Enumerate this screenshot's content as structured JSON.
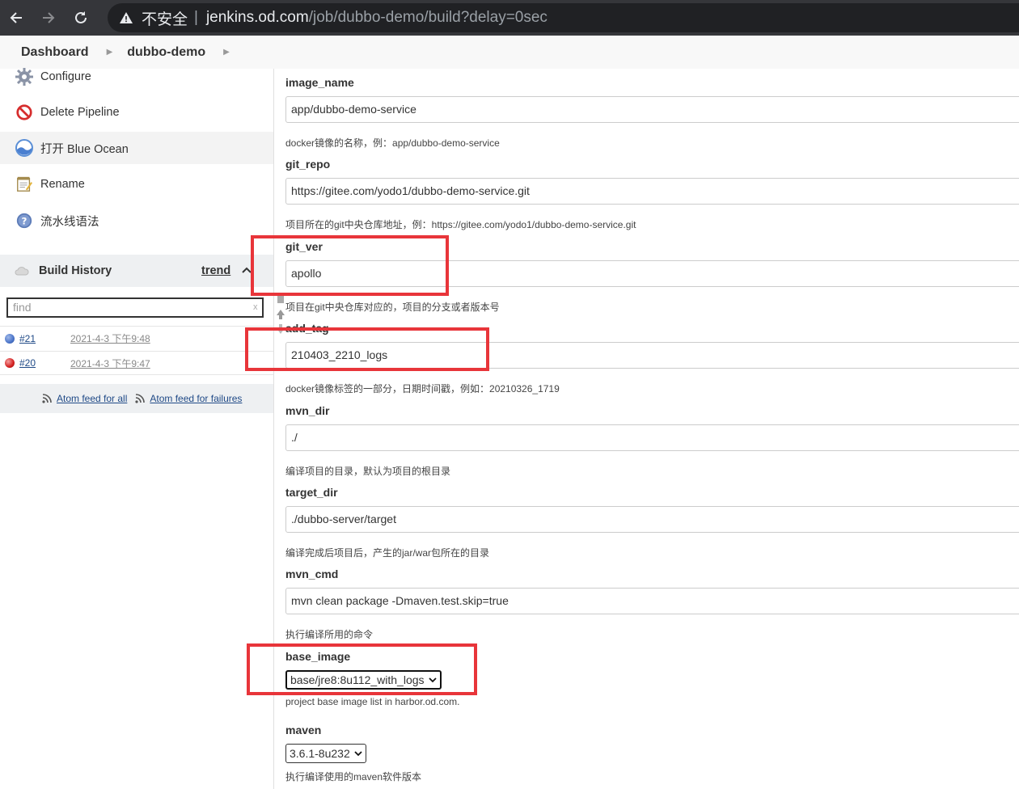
{
  "browser": {
    "insecure_label": "不安全",
    "separator": "|",
    "url_host": "jenkins.od.com",
    "url_path": "/job/dubbo-demo/build?delay=0sec"
  },
  "breadcrumb": {
    "items": [
      "Dashboard",
      "dubbo-demo"
    ]
  },
  "sidebar": {
    "tasks": [
      {
        "label": "Configure",
        "icon": "gear-icon"
      },
      {
        "label": "Delete Pipeline",
        "icon": "no-entry-icon"
      },
      {
        "label": "打开 Blue Ocean",
        "icon": "blue-ocean-icon"
      },
      {
        "label": "Rename",
        "icon": "notepad-icon"
      },
      {
        "label": "流水线语法",
        "icon": "help-icon"
      }
    ],
    "build_history": {
      "title": "Build History",
      "trend_label": "trend",
      "find_placeholder": "find",
      "find_clear": "x",
      "builds": [
        {
          "number": "#21",
          "date": "2021-4-3 下午9:48",
          "status": "success",
          "color": "#4a74c9"
        },
        {
          "number": "#20",
          "date": "2021-4-3 下午9:47",
          "status": "failed",
          "color": "#d32020"
        }
      ],
      "feed_all": "Atom feed for all",
      "feed_failures": "Atom feed for failures"
    }
  },
  "form": {
    "params": [
      {
        "name": "image_name",
        "value": "app/dubbo-demo-service",
        "description": "docker镜像的名称，例：app/dubbo-demo-service"
      },
      {
        "name": "git_repo",
        "value": "https://gitee.com/yodo1/dubbo-demo-service.git",
        "description": "项目所在的git中央仓库地址，例：https://gitee.com/yodo1/dubbo-demo-service.git"
      },
      {
        "name": "git_ver",
        "value": "apollo",
        "description": "项目在git中央仓库对应的，项目的分支或者版本号"
      },
      {
        "name": "add_tag",
        "value": "210403_2210_logs",
        "description": "docker镜像标签的一部分，日期时间戳，例如：20210326_1719"
      },
      {
        "name": "mvn_dir",
        "value": "./",
        "description": "编译项目的目录，默认为项目的根目录"
      },
      {
        "name": "target_dir",
        "value": "./dubbo-server/target",
        "description": "编译完成后项目后，产生的jar/war包所在的目录"
      },
      {
        "name": "mvn_cmd",
        "value": "mvn clean package -Dmaven.test.skip=true",
        "description": "执行编译所用的命令"
      }
    ],
    "base_image": {
      "name": "base_image",
      "selected": "base/jre8:8u112_with_logs",
      "description": "project base image list in harbor.od.com."
    },
    "maven": {
      "name": "maven",
      "selected": "3.6.1-8u232",
      "description": "执行编译使用的maven软件版本"
    }
  },
  "colors": {
    "highlight": "#e8353a",
    "browser_bar": "#35363a"
  }
}
